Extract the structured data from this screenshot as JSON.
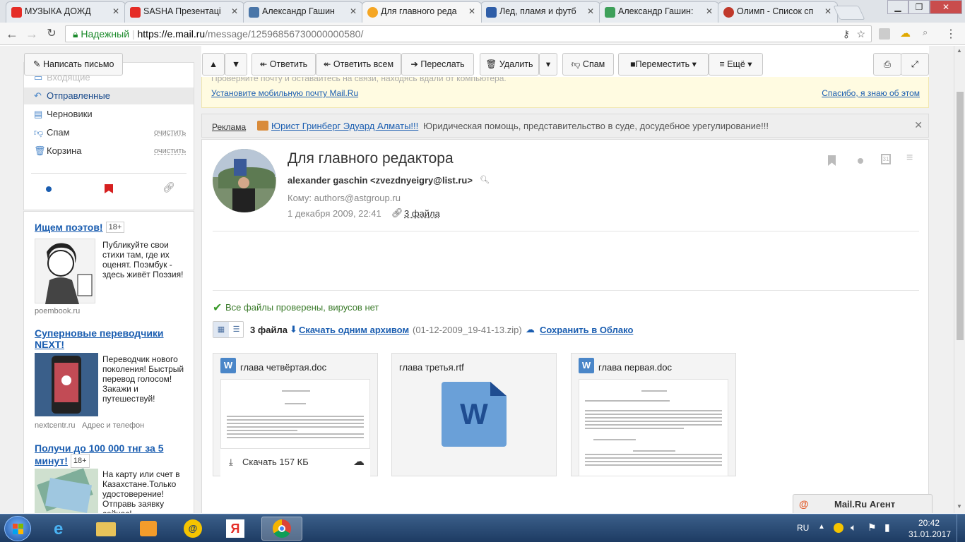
{
  "browser": {
    "tabs": [
      {
        "title": "МУЗЫКА ДОЖД",
        "favicon_color": "#e52d27"
      },
      {
        "title": "SASHA Презентаці",
        "favicon_color": "#e52d27"
      },
      {
        "title": "Александр Гашин",
        "favicon_color": "#4a76a8"
      },
      {
        "title": "Для главного реда",
        "favicon_color": "#f5a623"
      },
      {
        "title": "Лед, пламя и футб",
        "favicon_color": "#2f5ea8"
      },
      {
        "title": "Александр Гашин:",
        "favicon_color": "#3ea05a"
      },
      {
        "title": "Олимп - Список сп",
        "favicon_color": "#c0392b"
      }
    ],
    "secure_label": "Надежный",
    "url_host": "https://e.mail.ru",
    "url_path": "/message/12596856730000000580/"
  },
  "sidebar": {
    "compose": "Написать письмо",
    "folders": [
      {
        "label": "Входящие",
        "icon": "inbox-icon"
      },
      {
        "label": "Отправленные",
        "icon": "sent-icon"
      },
      {
        "label": "Черновики",
        "icon": "drafts-icon"
      },
      {
        "label": "Спам",
        "icon": "spam-icon",
        "action": "очистить"
      },
      {
        "label": "Корзина",
        "icon": "trash-icon",
        "action": "очистить"
      }
    ],
    "ads": [
      {
        "title": "Ищем поэтов!",
        "age": "18+",
        "text": "Публикуйте свои стихи там, где их оценят. Поэмбук - здесь живёт Поэзия!",
        "source": "poembook.ru"
      },
      {
        "title": "Суперновые переводчики NEXT!",
        "text": "Переводчик нового поколения! Быстрый перевод голосом! Закажи и путешествуй!",
        "source": "nextcentr.ru",
        "source_extra": "Адрес и телефон"
      },
      {
        "title": "Получи до 100 000 тнг за 5 минут!",
        "age": "18+",
        "text": "На карту или счет в Казахстане.Только удостоверение! Отправь заявку сейчас!"
      }
    ]
  },
  "toolbar": {
    "reply": "Ответить",
    "reply_all": "Ответить всем",
    "forward": "Переслать",
    "delete": "Удалить",
    "spam": "Спам",
    "move": "Переместить",
    "more": "≡ Ещё"
  },
  "banner": {
    "text": "Проверяйте почту и оставайтесь на связи, находясь вдали от компьютера.",
    "link": "Установите мобильную почту Mail.Ru",
    "dismiss": "Спасибо, я знаю об этом"
  },
  "adline": {
    "label": "Реклама",
    "title": "Юрист Гринберг Эдуард Алматы!!!",
    "text": "Юридическая помощь, представительство в суде, досудебное урегулирование!!!"
  },
  "message": {
    "subject": "Для главного редактора",
    "from": "alexander gaschin <zvezdnyeigry@list.ru>",
    "to": "Кому: authors@astgroup.ru",
    "date": "1 декабря 2009, 22:41",
    "files_link": "3 файла",
    "virus_check": "Все файлы проверены, вирусов нет",
    "files_count": "3 файла",
    "download_archive": "Скачать одним архивом",
    "archive_name": "(01-12-2009_19-41-13.zip)",
    "save_cloud": "Сохранить в Облако",
    "attachments": [
      {
        "name": "глава четвёртая.doc",
        "download": "Скачать 157 КБ"
      },
      {
        "name": "глава третья.rtf"
      },
      {
        "name": "глава первая.doc"
      }
    ]
  },
  "agent": {
    "label": "Mail.Ru Агент"
  },
  "taskbar": {
    "lang": "RU",
    "time": "20:42",
    "date": "31.01.2017"
  }
}
